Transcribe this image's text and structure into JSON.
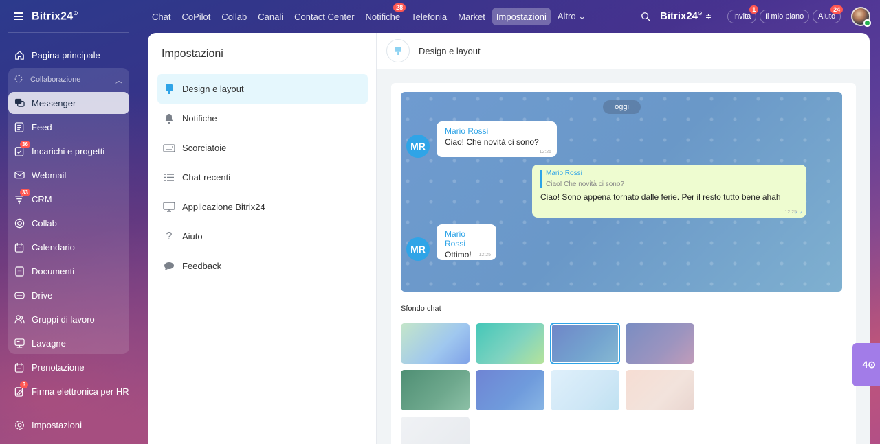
{
  "sidebar": {
    "logo": "Bitrix24",
    "logo_mark": "⊙",
    "home": "Pagina principale",
    "group_label": "Collaborazione",
    "items": [
      {
        "label": "Messenger",
        "badge": ""
      },
      {
        "label": "Feed",
        "badge": ""
      },
      {
        "label": "Incarichi e progetti",
        "badge": "36"
      },
      {
        "label": "Webmail",
        "badge": ""
      },
      {
        "label": "CRM",
        "badge": "33"
      },
      {
        "label": "Collab",
        "badge": ""
      },
      {
        "label": "Calendario",
        "badge": ""
      },
      {
        "label": "Documenti",
        "badge": ""
      },
      {
        "label": "Drive",
        "badge": ""
      },
      {
        "label": "Gruppi di lavoro",
        "badge": ""
      },
      {
        "label": "Lavagne",
        "badge": ""
      }
    ],
    "prenotazione": "Prenotazione",
    "firma": "Firma elettronica per HR",
    "firma_badge": "3",
    "impostazioni": "Impostazioni"
  },
  "topbar": {
    "tabs": [
      {
        "label": "Chat",
        "badge": ""
      },
      {
        "label": "CoPilot",
        "badge": ""
      },
      {
        "label": "Collab",
        "badge": ""
      },
      {
        "label": "Canali",
        "badge": ""
      },
      {
        "label": "Contact Center",
        "badge": ""
      },
      {
        "label": "Notifiche",
        "badge": "28"
      },
      {
        "label": "Telefonia",
        "badge": ""
      },
      {
        "label": "Market",
        "badge": ""
      },
      {
        "label": "Impostazioni",
        "badge": ""
      },
      {
        "label": "Altro ⌄",
        "badge": ""
      }
    ],
    "brand": "Bitrix24",
    "invite": "Invita",
    "invite_badge": "1",
    "plan": "Il mio piano",
    "help": "Aiuto",
    "help_badge": "24"
  },
  "settings": {
    "title": "Impostazioni",
    "menu": [
      "Design e layout",
      "Notifiche",
      "Scorciatoie",
      "Chat recenti",
      "Applicazione Bitrix24",
      "Aiuto",
      "Feedback"
    ],
    "section_title": "Design e layout",
    "preview": {
      "day": "oggi",
      "msg1": {
        "initials": "MR",
        "name": "Mario Rossi",
        "text": "Ciao! Che novità ci sono?",
        "time": "12:25"
      },
      "msg2": {
        "quote_name": "Mario Rossi",
        "quote_text": "Ciao! Che novità ci sono?",
        "text": "Ciao! Sono appena tornato dalle ferie. Per il resto tutto bene ahah",
        "time": "12:25"
      },
      "msg3": {
        "initials": "MR",
        "name": "Mario Rossi",
        "text": "Ottimo!",
        "time": "12:25"
      }
    },
    "bg_label": "Sfondo chat"
  },
  "edge_tab": "4⊙",
  "colors": {
    "accent": "#2fa4e7",
    "badge": "#ff5752",
    "active_menu": "#e5f7fd"
  }
}
